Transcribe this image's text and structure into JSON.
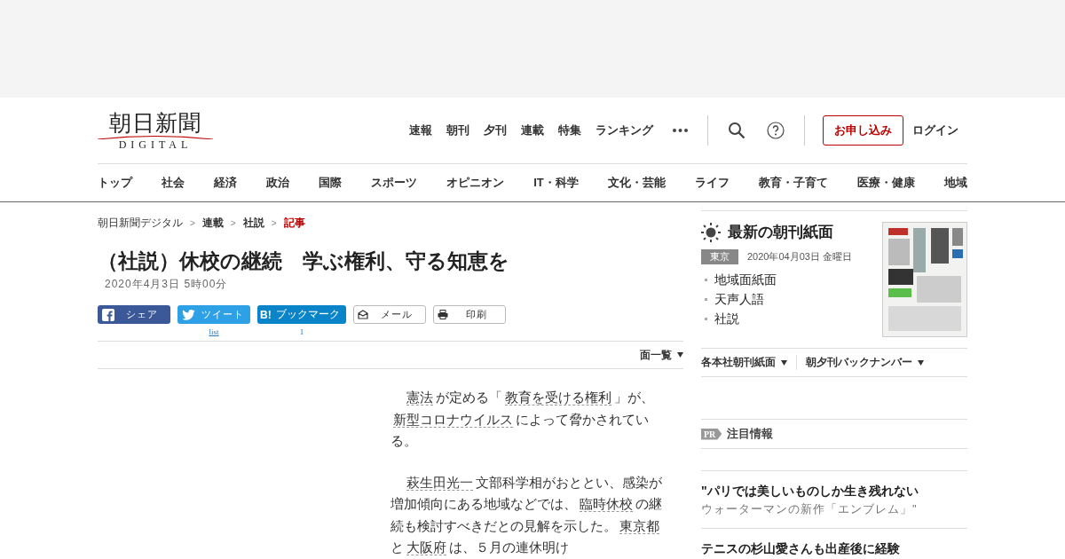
{
  "logo": {
    "title": "朝日新聞",
    "subtitle": "DIGITAL"
  },
  "top_nav": [
    "速報",
    "朝刊",
    "夕刊",
    "連載",
    "特集",
    "ランキング"
  ],
  "subscribe_button": "お申し込み",
  "login_link": "ログイン",
  "category_nav": [
    "トップ",
    "社会",
    "経済",
    "政治",
    "国際",
    "スポーツ",
    "オピニオン",
    "IT・科学",
    "文化・芸能",
    "ライフ",
    "教育・子育て",
    "医療・健康",
    "地域"
  ],
  "breadcrumb": {
    "separator": ">",
    "items": [
      {
        "label": "朝日新聞デジタル",
        "current": false,
        "bold": false
      },
      {
        "label": "連載",
        "current": false,
        "bold": true
      },
      {
        "label": "社説",
        "current": false,
        "bold": true
      },
      {
        "label": "記事",
        "current": true,
        "bold": true
      }
    ]
  },
  "article": {
    "title": "（社説）休校の継続　学ぶ権利、守る知恵を",
    "date": "2020年4月3日 5時00分",
    "share_buttons": [
      {
        "kind": "facebook",
        "label": "シェア"
      },
      {
        "kind": "twitter",
        "label": "ツイート",
        "count": "list"
      },
      {
        "kind": "hatena",
        "logo": "B!",
        "label": "ブックマーク",
        "count": "1"
      },
      {
        "kind": "mail",
        "label": "メール"
      },
      {
        "kind": "print",
        "label": "印刷"
      }
    ],
    "page_list": "面一覧",
    "paragraphs": [
      [
        {
          "text": "憲法",
          "link": true
        },
        {
          "text": "が定める「",
          "link": false
        },
        {
          "text": "教育を受ける権利",
          "link": true
        },
        {
          "text": "」が、",
          "link": false
        },
        {
          "text": "新型コロナウイルス",
          "link": true
        },
        {
          "text": "によって脅かされている。",
          "link": false
        }
      ],
      [
        {
          "text": "萩生田光一",
          "link": true
        },
        {
          "text": "文部科学相がおととい、感染が増加傾向にある地域などでは、",
          "link": false
        },
        {
          "text": "臨時休校",
          "link": true
        },
        {
          "text": "の継続も検討すべきだとの見解を示した。",
          "link": false
        },
        {
          "text": "東京都",
          "link": true
        },
        {
          "text": "と",
          "link": false
        },
        {
          "text": "大阪府",
          "link": true
        },
        {
          "text": "は、５月の連休明け",
          "link": false
        }
      ]
    ]
  },
  "sidebar": {
    "paper_title": "最新の朝刊紙面",
    "edition": "東京",
    "paper_date": "2020年04月03日 金曜日",
    "paper_links": [
      "地域面紙面",
      "天声人語",
      "社説"
    ],
    "dropdowns": [
      "各本社朝刊紙面",
      "朝夕刊バックナンバー"
    ],
    "pr_badge": "PR",
    "pr_title": "注目情報",
    "promos": [
      {
        "title": "\"パリでは美しいものしか生き残れない",
        "subtitle": "ウォーターマンの新作「エンブレム」\""
      },
      {
        "title": "テニスの杉山愛さんも出産後に経験"
      }
    ]
  }
}
